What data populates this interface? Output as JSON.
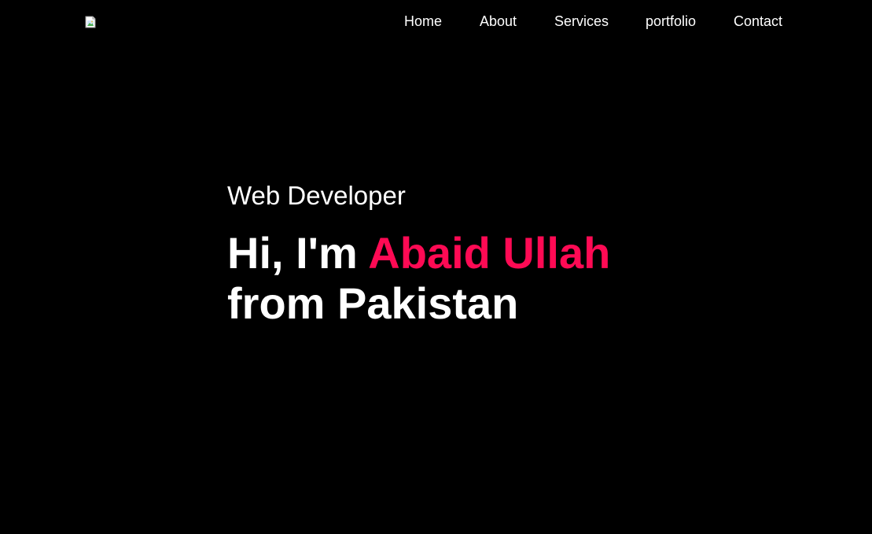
{
  "colors": {
    "background": "#000000",
    "text": "#ffffff",
    "accent": "#ff0a54"
  },
  "header": {
    "logo_icon": "broken-image-icon",
    "nav": [
      {
        "label": "Home"
      },
      {
        "label": "About"
      },
      {
        "label": "Services"
      },
      {
        "label": "portfolio"
      },
      {
        "label": "Contact"
      }
    ]
  },
  "hero": {
    "subtitle": "Web Developer",
    "greeting": "Hi, I'm",
    "name": "Abaid Ullah",
    "location_line": "from Pakistan"
  }
}
